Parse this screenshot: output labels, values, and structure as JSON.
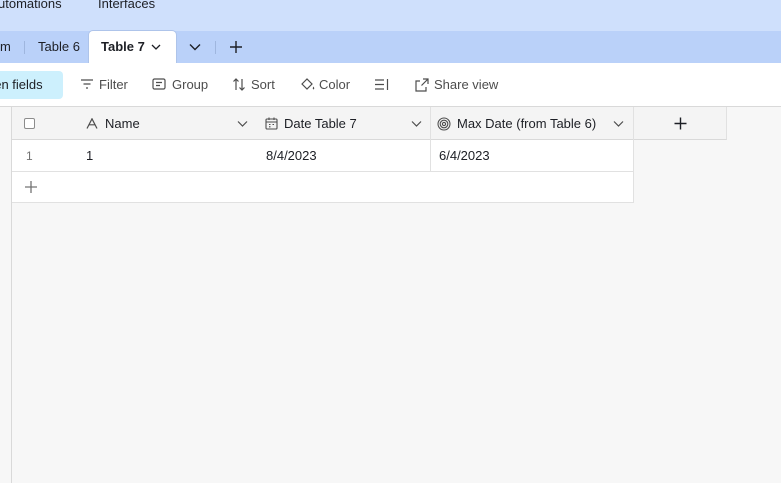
{
  "topnav": {
    "items": [
      {
        "label": "utomations"
      },
      {
        "label": "Interfaces"
      }
    ]
  },
  "tabs": {
    "items": [
      {
        "label": "m"
      },
      {
        "label": "Table 6"
      },
      {
        "label": "Table 7",
        "active": true
      }
    ]
  },
  "toolbar": {
    "hidden_fields": "den fields",
    "filter": "Filter",
    "group": "Group",
    "sort": "Sort",
    "color": "Color",
    "share_view": "Share view"
  },
  "grid": {
    "columns": [
      {
        "label": "Name",
        "icon": "text-field-icon"
      },
      {
        "label": "Date Table 7",
        "icon": "calendar-icon"
      },
      {
        "label": "Max Date (from Table 6)",
        "icon": "rollup-icon"
      }
    ],
    "rows": [
      {
        "row_number": "1",
        "name": "1",
        "date_table_7": "8/4/2023",
        "max_date": "6/4/2023"
      }
    ]
  },
  "colors": {
    "topnav_bg": "#cfe0fc",
    "tabbar_bg": "#bad1f9",
    "hidden_fields_bg": "#cdf0fd",
    "grid_bg": "#f7f7f7"
  }
}
